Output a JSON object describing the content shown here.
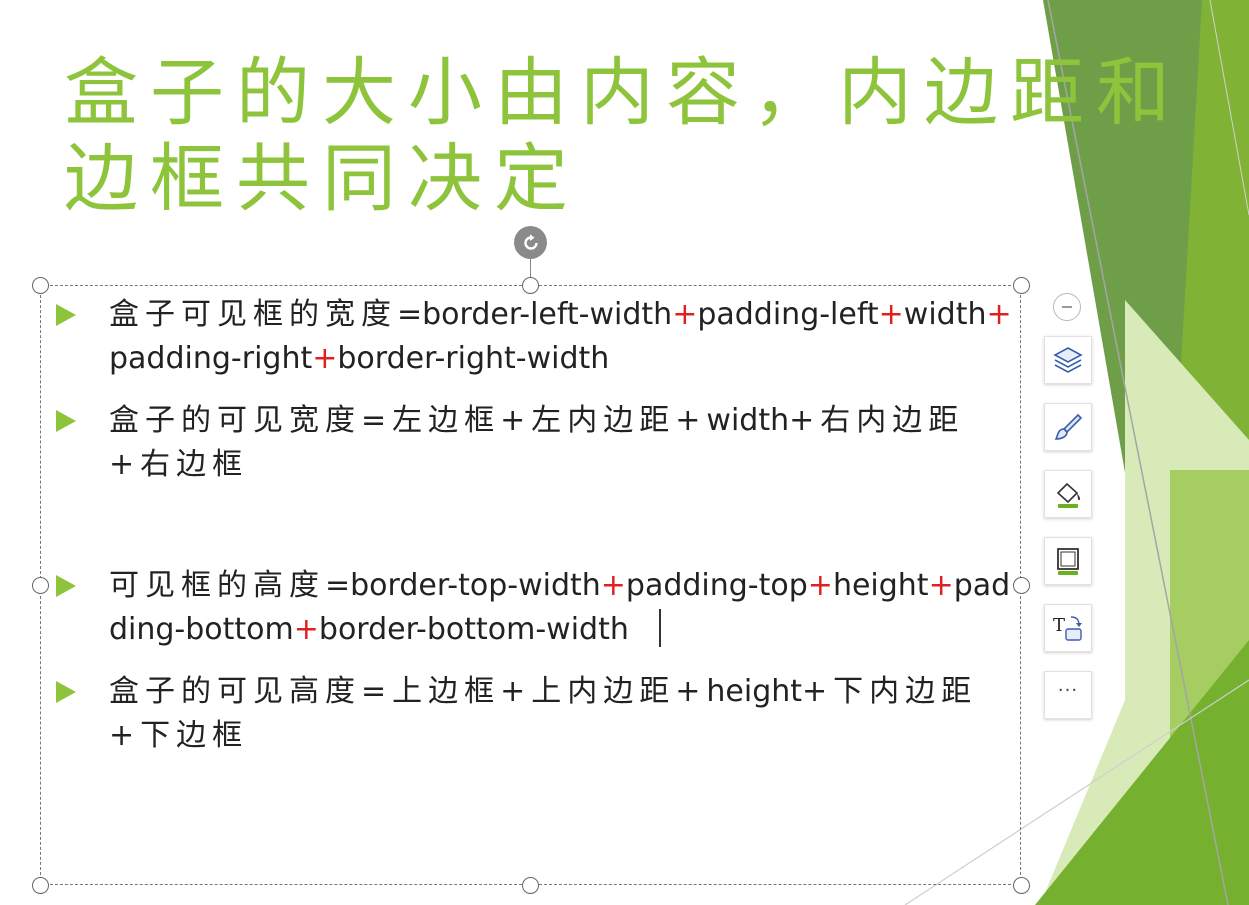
{
  "slide": {
    "title_lines": [
      "盒子的大小由内容，内边距和",
      "边框共同决定"
    ],
    "accent_color": "#8dc43c",
    "operator_color": "#e02020"
  },
  "bullets": [
    {
      "segments": [
        {
          "t": "盒子可见框的宽度",
          "k": "cjk"
        },
        {
          "t": "=border-left-width",
          "k": "n"
        },
        {
          "t": "+",
          "k": "plus"
        },
        {
          "t": "padding-left",
          "k": "n"
        },
        {
          "t": "+",
          "k": "plus"
        },
        {
          "t": "width",
          "k": "n"
        },
        {
          "t": "+",
          "k": "plus"
        },
        {
          "t": "padding-right",
          "k": "n"
        },
        {
          "t": "+",
          "k": "plus"
        },
        {
          "t": "border-right-width",
          "k": "n"
        }
      ]
    },
    {
      "segments": [
        {
          "t": "盒子的可见宽度=左边框+左内边距+",
          "k": "cjk"
        },
        {
          "t": "width",
          "k": "n"
        },
        {
          "t": "+右内边距+右边框",
          "k": "cjk"
        }
      ]
    },
    {
      "segments": [
        {
          "t": "可见框的高度",
          "k": "cjk"
        },
        {
          "t": "=border-top-width",
          "k": "n"
        },
        {
          "t": "+",
          "k": "plus"
        },
        {
          "t": "padding-top",
          "k": "n"
        },
        {
          "t": "+",
          "k": "plus"
        },
        {
          "t": "height",
          "k": "n"
        },
        {
          "t": "+",
          "k": "plus"
        },
        {
          "t": "padding-bottom",
          "k": "n"
        },
        {
          "t": "+",
          "k": "plus"
        },
        {
          "t": "border-bottom-width",
          "k": "n"
        }
      ]
    },
    {
      "segments": [
        {
          "t": "盒子的可见高度=上边框+上内边距+",
          "k": "cjk"
        },
        {
          "t": "height",
          "k": "n"
        },
        {
          "t": "+下内边距+下边框",
          "k": "cjk"
        }
      ]
    }
  ],
  "toolbar": {
    "items": [
      {
        "name": "layers-icon"
      },
      {
        "name": "brush-icon"
      },
      {
        "name": "fill-bucket-icon"
      },
      {
        "name": "outline-icon"
      },
      {
        "name": "text-wrap-icon",
        "label": "T"
      },
      {
        "name": "more-icon",
        "label": "···"
      }
    ]
  }
}
